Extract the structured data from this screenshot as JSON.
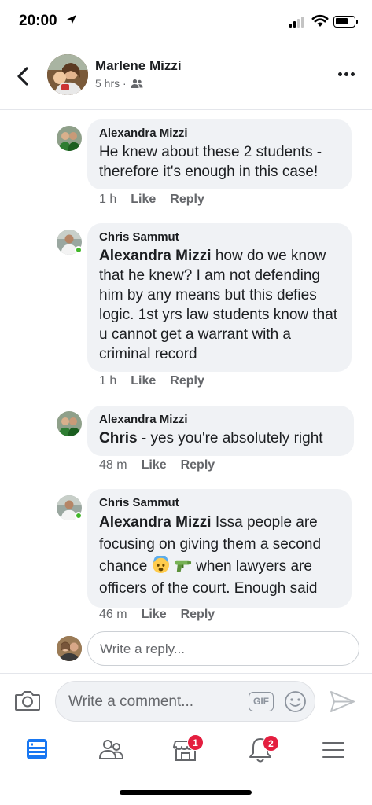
{
  "status_bar": {
    "time": "20:00"
  },
  "header": {
    "name": "Marlene Mizzi",
    "meta": "5 hrs ·"
  },
  "comments": [
    {
      "author": "Alexandra Mizzi",
      "mention": "",
      "text": "He knew about these 2 students - therefore it's enough in this case!",
      "time": "1 h",
      "like": "Like",
      "reply": "Reply",
      "online": false
    },
    {
      "author": "Chris Sammut",
      "mention": "Alexandra Mizzi",
      "text": " how do we know that he knew? I am not defending him by any means but this defies logic. 1st yrs law students know that u cannot get a warrant with a criminal record",
      "time": "1 h",
      "like": "Like",
      "reply": "Reply",
      "online": true
    },
    {
      "author": "Alexandra Mizzi",
      "mention": "Chris",
      "text": " - yes you're absolutely right",
      "time": "48 m",
      "like": "Like",
      "reply": "Reply",
      "online": false
    },
    {
      "author": "Chris Sammut",
      "mention": "Alexandra Mizzi",
      "text_before": " Issa people are focusing on giving them a second chance ",
      "emojis": [
        "fearful-face",
        "water-pistol"
      ],
      "text_after": " when lawyers are officers of the court. Enough said",
      "time": "46 m",
      "like": "Like",
      "reply": "Reply",
      "online": true
    }
  ],
  "reply_box": {
    "placeholder": "Write a reply..."
  },
  "comment_bar": {
    "placeholder": "Write a comment...",
    "gif_label": "GIF"
  },
  "tab_bar": {
    "tabs": [
      {
        "icon": "news-feed-icon",
        "badge": "",
        "active": true
      },
      {
        "icon": "friends-icon",
        "badge": ""
      },
      {
        "icon": "marketplace-icon",
        "badge": "1"
      },
      {
        "icon": "notifications-bell-icon",
        "badge": "2"
      },
      {
        "icon": "menu-icon",
        "badge": ""
      }
    ]
  },
  "colors": {
    "accent": "#1877f2",
    "bubble": "#f0f2f5",
    "secondary_text": "#65676b",
    "online": "#42b72a",
    "badge": "#e41e3f"
  }
}
